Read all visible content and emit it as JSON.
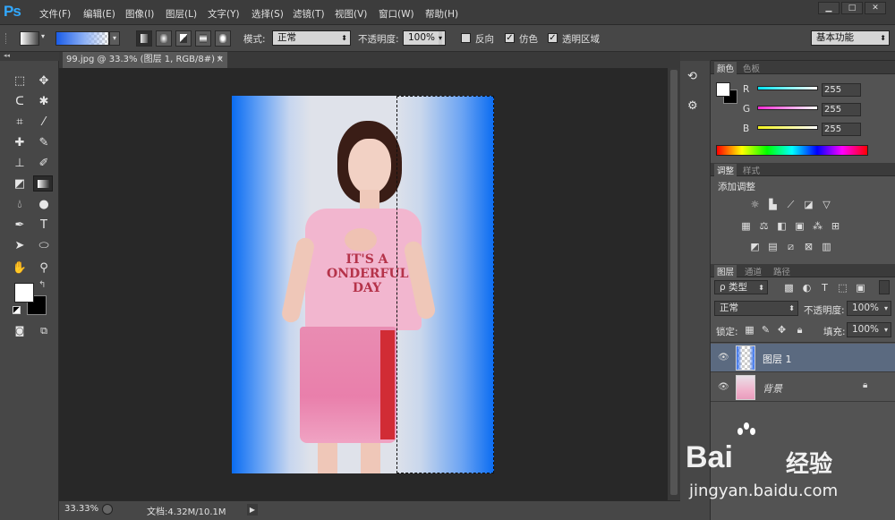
{
  "app": {
    "logo": "Ps"
  },
  "menu": [
    "文件(F)",
    "编辑(E)",
    "图像(I)",
    "图层(L)",
    "文字(Y)",
    "选择(S)",
    "滤镜(T)",
    "视图(V)",
    "窗口(W)",
    "帮助(H)"
  ],
  "window_controls": {
    "minimize": "▁",
    "maximize": "□",
    "close": "✕"
  },
  "options": {
    "mode_label": "模式:",
    "mode_value": "正常",
    "opacity_label": "不透明度:",
    "opacity_value": "100%",
    "reverse_label": "反向",
    "dither_label": "仿色",
    "transparency_label": "透明区域",
    "workspace": "基本功能",
    "reverse_checked": false,
    "dither_checked": true,
    "transparency_checked": true
  },
  "document": {
    "tab_title": "99.jpg @ 33.3% (图层 1, RGB/8#) *",
    "tab_close": "×"
  },
  "status": {
    "zoom": "33.33%",
    "doc_info": "文档:4.32M/10.1M"
  },
  "photo": {
    "shirt_text_1": "IT'S A",
    "shirt_text_2": "ONDERFUL",
    "shirt_text_3": "DAY",
    "gradient_colors": {
      "blue": "#0a6cf2",
      "light": "#d6dde8"
    }
  },
  "color_panel": {
    "tabs": [
      "颜色",
      "色板"
    ],
    "channels": [
      {
        "label": "R",
        "value": "255",
        "color": "#00e5ff"
      },
      {
        "label": "G",
        "value": "255",
        "color": "#ff2bd6"
      },
      {
        "label": "B",
        "value": "255",
        "color": "#f2f21a"
      }
    ]
  },
  "adjust_panel": {
    "tabs": [
      "调整",
      "样式"
    ],
    "title": "添加调整"
  },
  "layers_panel": {
    "tabs": [
      "图层",
      "通道",
      "路径"
    ],
    "filter_kind": "ρ 类型",
    "blend_mode": "正常",
    "opacity_label": "不透明度:",
    "opacity_value": "100%",
    "lock_label": "锁定:",
    "fill_label": "填充:",
    "fill_value": "100%",
    "layers": [
      {
        "name": "图层 1",
        "selected": true
      },
      {
        "name": "背景",
        "selected": false
      }
    ]
  },
  "watermark": {
    "logo": "Bai",
    "brand": "经验",
    "url": "jingyan.baidu.com"
  }
}
